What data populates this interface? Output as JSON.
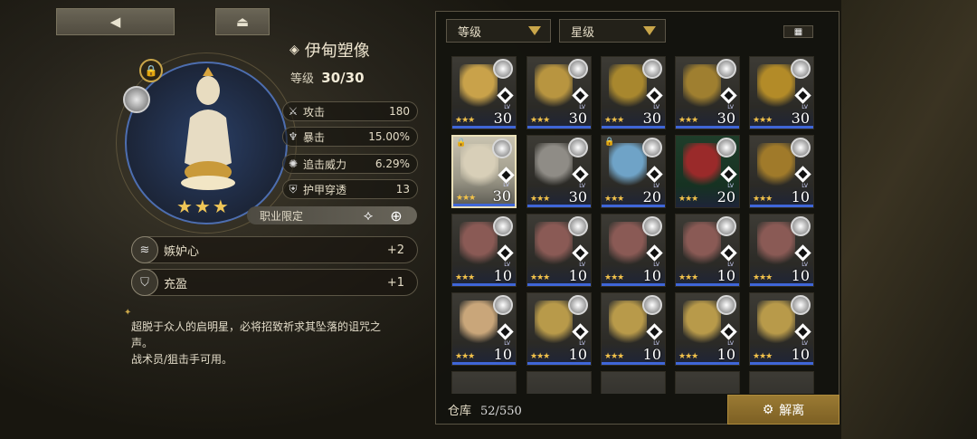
{
  "nav": {
    "back_icon": "triangle-left-icon",
    "home_icon": "eject-icon"
  },
  "item": {
    "name": "伊甸塑像",
    "level_label": "等级",
    "level_value": "30/30",
    "stars": "★★★"
  },
  "stats": [
    {
      "icon": "attack-icon",
      "name": "攻击",
      "value": "180"
    },
    {
      "icon": "crit-icon",
      "name": "暴击",
      "value": "15.00%"
    },
    {
      "icon": "pursuit-icon",
      "name": "追击威力",
      "value": "6.29%"
    },
    {
      "icon": "armor-pierce-icon",
      "name": "护甲穿透",
      "value": "13"
    }
  ],
  "job_label": "职业限定",
  "skills": [
    {
      "name": "嫉妒心",
      "value": "+2"
    },
    {
      "name": "充盈",
      "value": "+1"
    }
  ],
  "description": {
    "line1": "超脱于众人的启明星，必将招致祈求其坠落的诅咒之",
    "line2": "声。",
    "line3": "战术员/狙击手可用。"
  },
  "filters": {
    "level": "等级",
    "star": "星级"
  },
  "grid": [
    {
      "level": "30",
      "stars": "★★★",
      "art": "#c9a24a"
    },
    {
      "level": "30",
      "stars": "★★★",
      "art": "#b89540"
    },
    {
      "level": "30",
      "stars": "★★★",
      "art": "#a8872e"
    },
    {
      "level": "30",
      "stars": "★★★",
      "art": "#9f7f30"
    },
    {
      "level": "30",
      "stars": "★★★",
      "art": "#b38b28"
    },
    {
      "level": "30",
      "stars": "★★★",
      "art": "#d8cfb8"
    },
    {
      "level": "30",
      "stars": "★★★",
      "art": "#8f8c86"
    },
    {
      "level": "20",
      "stars": "★★★",
      "art": "#6fa3c7"
    },
    {
      "level": "20",
      "stars": "★★★",
      "art": "#9a2a2a"
    },
    {
      "level": "10",
      "stars": "★★★",
      "art": "#a07a2a"
    },
    {
      "level": "10",
      "stars": "★★★",
      "art": "#8a5a55"
    },
    {
      "level": "10",
      "stars": "★★★",
      "art": "#8a5a55"
    },
    {
      "level": "10",
      "stars": "★★★",
      "art": "#8a5a55"
    },
    {
      "level": "10",
      "stars": "★★★",
      "art": "#8a5a55"
    },
    {
      "level": "10",
      "stars": "★★★",
      "art": "#8a5a55"
    },
    {
      "level": "10",
      "stars": "★★★",
      "art": "#c9a67a"
    },
    {
      "level": "10",
      "stars": "★★★",
      "art": "#b89a4a"
    },
    {
      "level": "10",
      "stars": "★★★",
      "art": "#b89a4a"
    },
    {
      "level": "10",
      "stars": "★★★",
      "art": "#b89a4a"
    },
    {
      "level": "10",
      "stars": "★★★",
      "art": "#b89a4a"
    }
  ],
  "storage": {
    "label": "仓库",
    "value": "52/550"
  },
  "dismantle_label": "解离"
}
